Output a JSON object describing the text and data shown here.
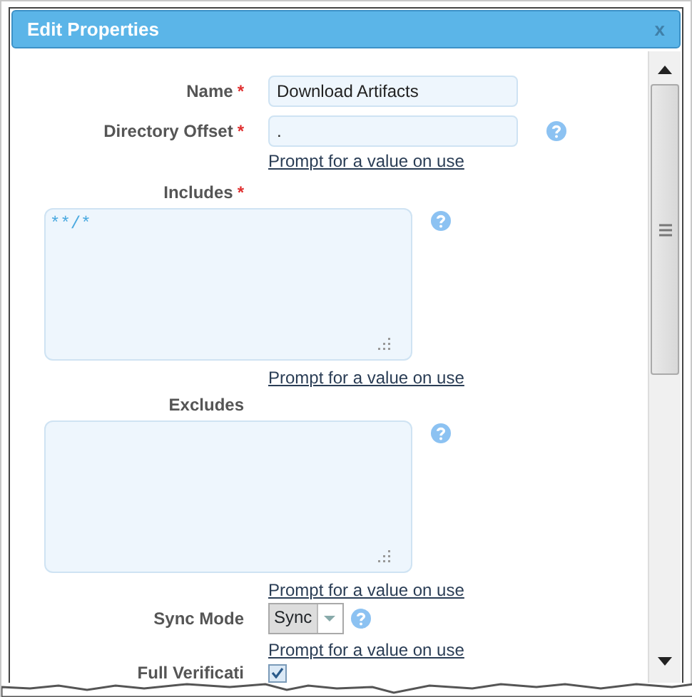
{
  "dialog": {
    "title": "Edit Properties",
    "close": "x"
  },
  "fields": [
    {
      "kind": "text",
      "label": "Name",
      "required_mark": "*",
      "value": "Download Artifacts"
    },
    {
      "kind": "text",
      "label": "Directory Offset",
      "required_mark": "*",
      "value": ".",
      "help": true,
      "prompt_link": "Prompt for a value on use"
    },
    {
      "kind": "textarea",
      "label": "Includes",
      "required_mark": "*",
      "value": "**/*",
      "help": true,
      "prompt_link": "Prompt for a value on use"
    },
    {
      "kind": "textarea",
      "label": "Excludes",
      "help": true,
      "prompt_link": "Prompt for a value on use"
    },
    {
      "kind": "select",
      "label": "Sync Mode",
      "value": "Sync",
      "help": true,
      "prompt_link": "Prompt for a value on use"
    },
    {
      "kind": "checkbox",
      "label": "Full Verificati",
      "checked": true
    }
  ]
}
